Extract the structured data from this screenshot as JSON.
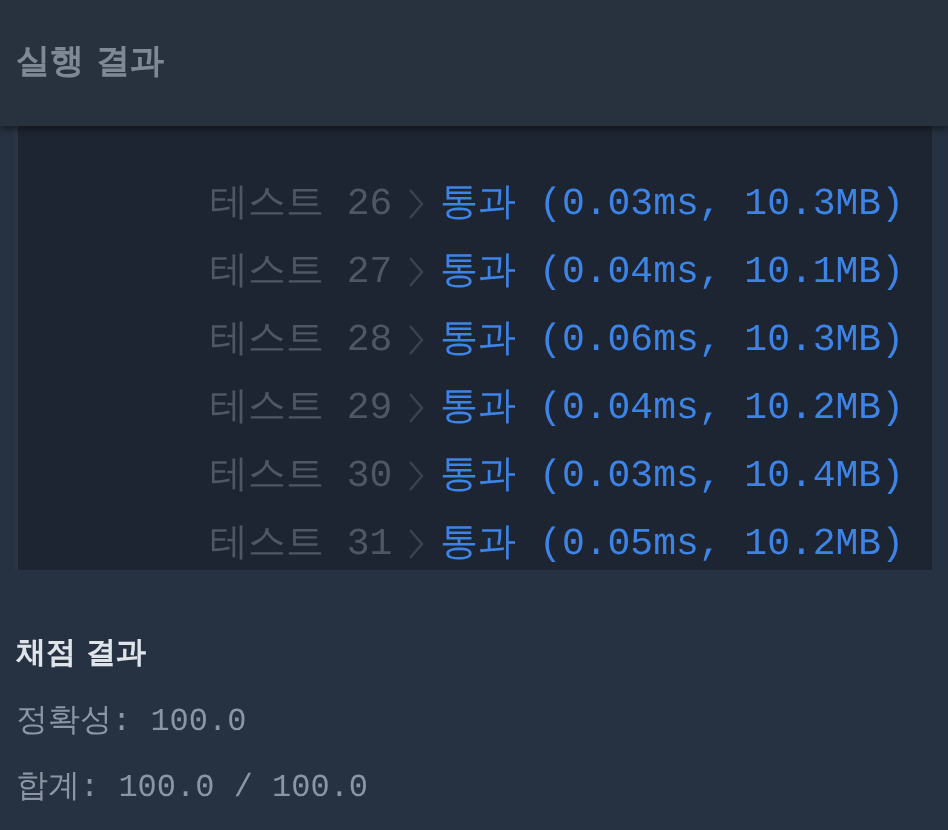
{
  "header": {
    "title": "실행 결과"
  },
  "tests": [
    {
      "label": "테스트 26",
      "result": "통과 (0.03ms, 10.3MB)"
    },
    {
      "label": "테스트 27",
      "result": "통과 (0.04ms, 10.1MB)"
    },
    {
      "label": "테스트 28",
      "result": "통과 (0.06ms, 10.3MB)"
    },
    {
      "label": "테스트 29",
      "result": "통과 (0.04ms, 10.2MB)"
    },
    {
      "label": "테스트 30",
      "result": "통과 (0.03ms, 10.4MB)"
    },
    {
      "label": "테스트 31",
      "result": "통과 (0.05ms, 10.2MB)"
    }
  ],
  "grading": {
    "title": "채점 결과",
    "lines": [
      "정확성: 100.0",
      "합계: 100.0 / 100.0"
    ]
  }
}
